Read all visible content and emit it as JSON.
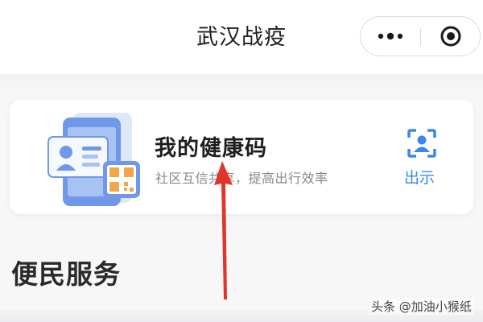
{
  "nav": {
    "title": "武汉战疫",
    "more_icon": "more-dots-icon",
    "close_icon": "target-close-icon"
  },
  "health_card": {
    "title": "我的健康码",
    "subtitle": "社区互信共享，提高出行效率",
    "show_label": "出示",
    "illustration_icon": "phone-id-qrcode-illustration",
    "show_icon": "scan-person-icon"
  },
  "section": {
    "title": "便民服务"
  },
  "annotation": {
    "arrow_icon": "red-up-arrow-icon",
    "arrow_color": "#e0352b"
  },
  "watermark": {
    "text": "头条 @加油小猴纸"
  },
  "colors": {
    "accent": "#3b86f2",
    "illustration_blue": "#6f98ea",
    "illustration_orange": "#f2a645"
  }
}
